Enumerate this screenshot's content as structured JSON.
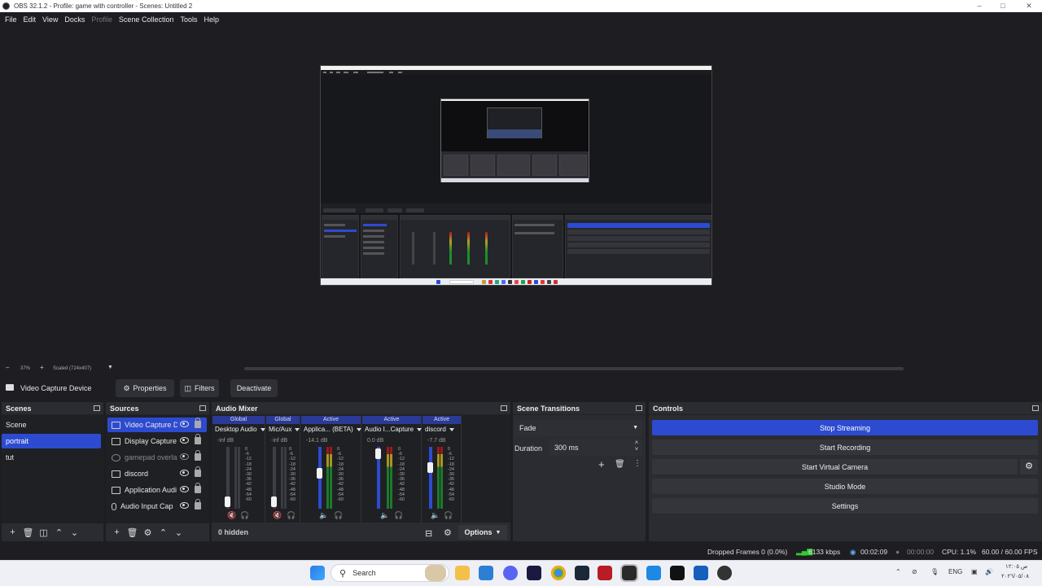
{
  "window": {
    "title": "OBS 32.1.2 - Profile: game with controller - Scenes: Untitled 2"
  },
  "menu": [
    "File",
    "Edit",
    "View",
    "Docks",
    "Profile",
    "Scene Collection",
    "Tools",
    "Help"
  ],
  "zoom": {
    "value": "37%",
    "scaled": "Scaled (724x407)"
  },
  "source_toolbar": {
    "selected_source": "Video Capture Device",
    "properties": "Properties",
    "filters": "Filters",
    "deactivate": "Deactivate"
  },
  "scenes": {
    "title": "Scenes",
    "items": [
      "Scene",
      "portrait",
      "tut"
    ],
    "selected": "portrait"
  },
  "sources": {
    "title": "Sources",
    "items": [
      "Video Capture D",
      "Display Capture",
      "gamepad overla",
      "discord",
      "Application Audi",
      "Audio Input Cap"
    ]
  },
  "mixer": {
    "title": "Audio Mixer",
    "channels": [
      {
        "status": "Global",
        "name": "Desktop Audio",
        "db": "-inf dB"
      },
      {
        "status": "Global",
        "name": "Mic/Aux",
        "db": "-inf dB"
      },
      {
        "status": "Active",
        "name": "Applica... (BETA)",
        "db": "-14.1 dB"
      },
      {
        "status": "Active",
        "name": "Audio I...Capture",
        "db": "0.0 dB"
      },
      {
        "status": "Active",
        "name": "discord",
        "db": "-7.7 dB"
      }
    ],
    "scale": [
      "0",
      "-6",
      "-12",
      "-18",
      "-24",
      "-30",
      "-36",
      "-42",
      "-48",
      "-54",
      "-60"
    ],
    "hidden": "0 hidden",
    "options": "Options"
  },
  "transitions": {
    "title": "Scene Transitions",
    "type": "Fade",
    "duration_label": "Duration",
    "duration": "300 ms"
  },
  "controls": {
    "title": "Controls",
    "stop_streaming": "Stop Streaming",
    "start_recording": "Start Recording",
    "start_virtual_camera": "Start Virtual Camera",
    "studio_mode": "Studio Mode",
    "settings": "Settings"
  },
  "status": {
    "dropped_frames": "Dropped Frames 0 (0.0%)",
    "bitrate": "6133 kbps",
    "stream_time": "00:02:09",
    "record_time": "00:00:00",
    "cpu": "CPU: 1.1%",
    "fps": "60.00 / 60.00 FPS"
  },
  "taskbar": {
    "search": "Search",
    "lang": "ENG",
    "time": "ص ١٢:٠٥",
    "date": "٢٠٢٦/٠٥/٠٨"
  },
  "colors": {
    "accent": "#2d4bd0",
    "panel": "#2b2c31",
    "bg": "#1e1e22"
  }
}
